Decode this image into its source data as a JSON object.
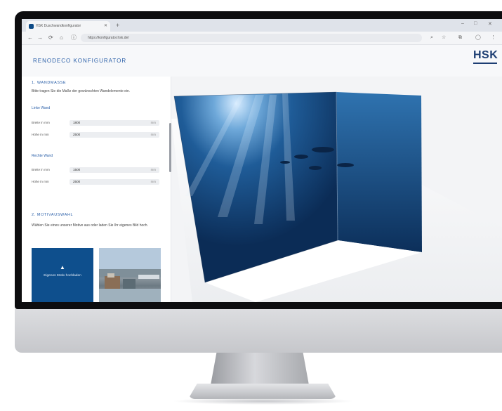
{
  "browser": {
    "tab_title": "HSK Duschwandkonfigurator",
    "url": "https://konfigurator.hsk.de/",
    "new_tab": "+",
    "nav": {
      "back": "←",
      "forward": "→",
      "reload": "⟳",
      "home": "⌂",
      "info": "ⓘ"
    },
    "window": {
      "minimize": "–",
      "maximize": "□",
      "close": "✕"
    }
  },
  "page": {
    "title": "RENODECO KONFIGURATOR",
    "logo": "HSK"
  },
  "sidebar": {
    "section1": {
      "title": "1. WANDMASSE",
      "description": "Bitte tragen Sie die Maße der gewünschten Wandelemente ein.",
      "groups": [
        {
          "label": "Linke Wand",
          "rows": [
            {
              "label": "Breite in mm",
              "value": "1800",
              "unit": "mm"
            },
            {
              "label": "Höhe in mm",
              "value": "2500",
              "unit": "mm"
            }
          ]
        },
        {
          "label": "Rechte Wand",
          "rows": [
            {
              "label": "Breite in mm",
              "value": "1500",
              "unit": "mm"
            },
            {
              "label": "Höhe in mm",
              "value": "2500",
              "unit": "mm"
            }
          ]
        }
      ]
    },
    "section2": {
      "title": "2. MOTIVAUSWAHL",
      "description": "Wählen Sie eines unserer Motive aus oder laden Sie Ihr eigenes Bild hoch.",
      "upload_icon": "upload-icon",
      "upload_label": "Eigenes Motiv hochladen"
    }
  },
  "colors": {
    "accent": "#2a5fa8",
    "brand": "#1d3e73",
    "tile": "#0e4f8d"
  }
}
